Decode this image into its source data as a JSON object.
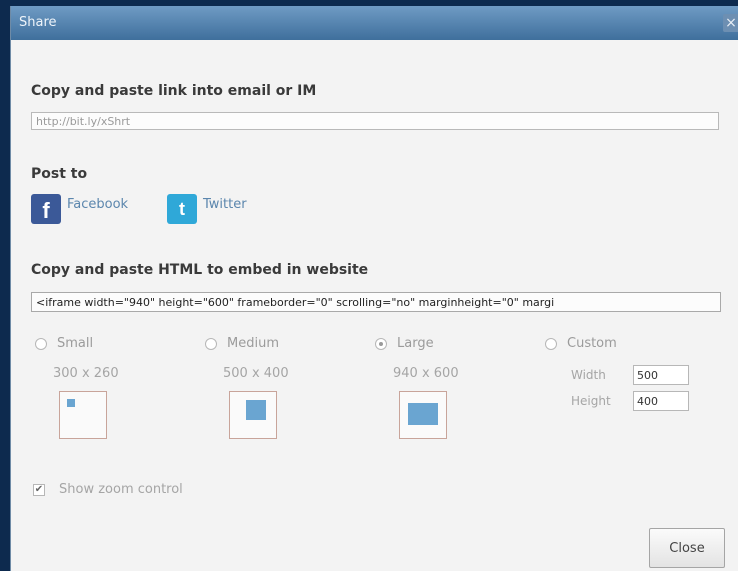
{
  "dialog": {
    "title": "Share",
    "close_icon": "×",
    "link_section": {
      "heading": "Copy and paste link into email or IM",
      "link_value": "http://bit.ly/xShrt"
    },
    "post_section": {
      "heading": "Post to",
      "facebook_icon": "f",
      "facebook_label": "Facebook",
      "twitter_icon": "t",
      "twitter_label": "Twitter"
    },
    "embed_section": {
      "heading": "Copy and paste HTML to embed in website",
      "code_value": "<iframe width=\"940\" height=\"600\" frameborder=\"0\" scrolling=\"no\" marginheight=\"0\" margi",
      "size_options": [
        {
          "label": "Small",
          "dims": "300 x 260",
          "selected": false
        },
        {
          "label": "Medium",
          "dims": "500 x 400",
          "selected": false
        },
        {
          "label": "Large",
          "dims": "940 x 600",
          "selected": true
        },
        {
          "label": "Custom",
          "selected": false
        }
      ],
      "custom": {
        "width_label": "Width",
        "width_value": "500",
        "height_label": "Height",
        "height_value": "400"
      }
    },
    "zoom_control": {
      "label": "Show zoom control",
      "checked": true,
      "check_mark": "✔"
    },
    "close_button": "Close"
  }
}
